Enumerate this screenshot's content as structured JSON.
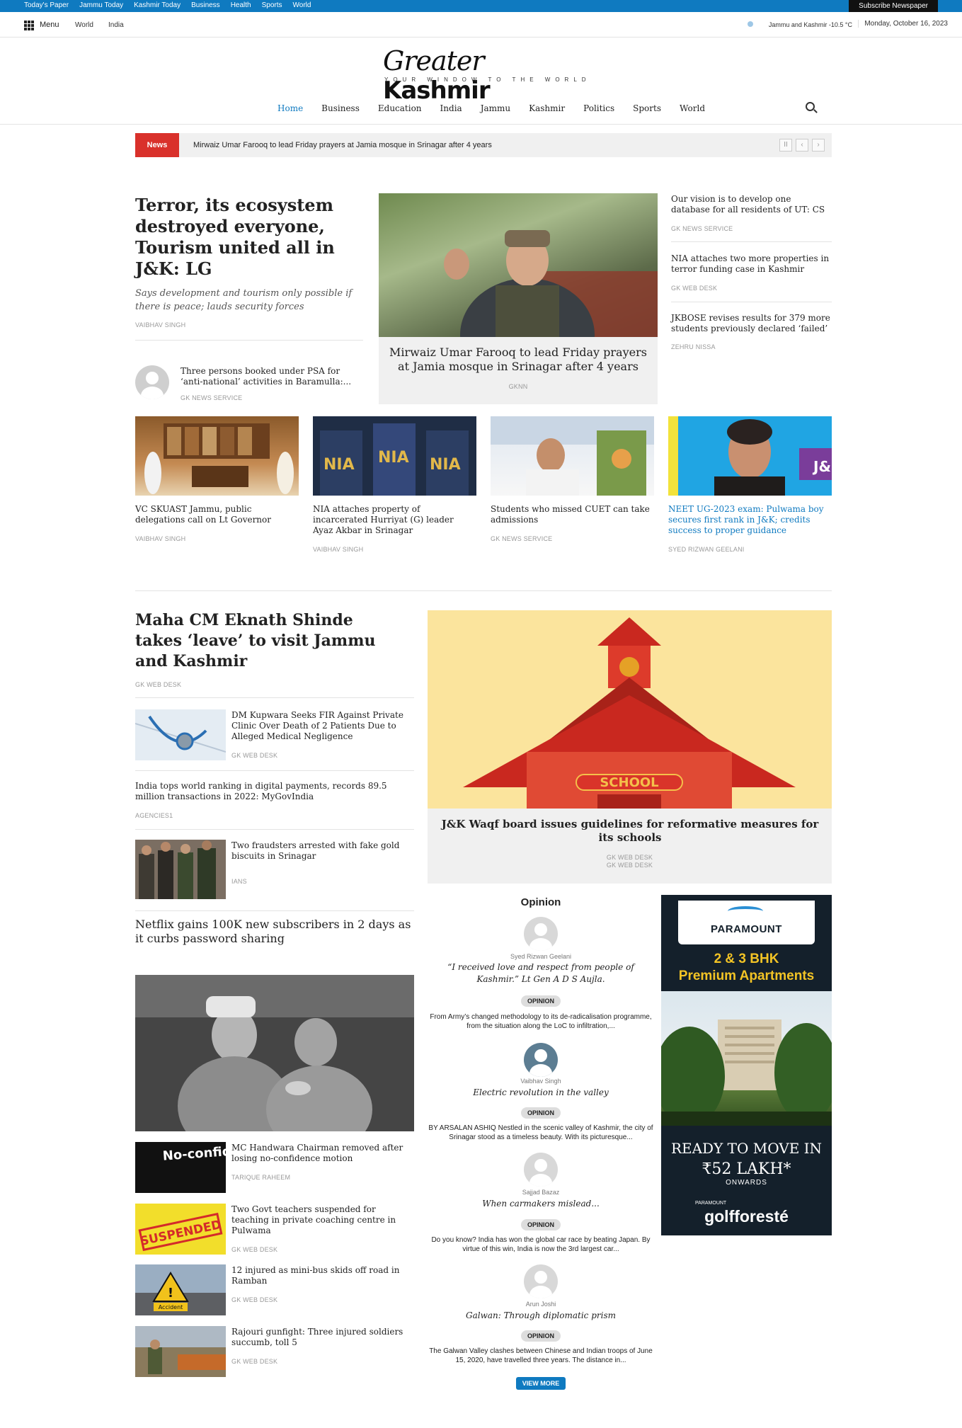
{
  "topbar": {
    "links": [
      "Today's Paper",
      "Jammu Today",
      "Kashmir Today",
      "Business",
      "Health",
      "Sports",
      "World"
    ],
    "subscribe": "Subscribe Newspaper"
  },
  "nav2": {
    "menu": "Menu",
    "world": "World",
    "india": "India",
    "weather": "Jammu and Kashmir  -10.5 °C",
    "date": "Monday, October 16, 2023"
  },
  "logo": {
    "greater": "Greater",
    "kashmir": "Kashmir",
    "tagline": "YOUR WINDOW TO THE WORLD"
  },
  "mainnav": [
    "Home",
    "Business",
    "Education",
    "India",
    "Jammu",
    "Kashmir",
    "Politics",
    "Sports",
    "World"
  ],
  "ticker": {
    "label": "News",
    "text": "Mirwaiz Umar Farooq to lead Friday prayers at Jamia mosque in Srinagar after 4 years"
  },
  "lead": {
    "title": "Terror, its ecosystem destroyed everyone, Tourism united all in J&K: LG",
    "subtitle": "Says development and tourism only possible if there is peace; lauds security forces",
    "author": "VAIBHAV SINGH"
  },
  "small_story": {
    "title": "Three persons booked under PSA for ‘anti-national’ activities in Baramulla:...",
    "author": "GK NEWS SERVICE"
  },
  "center_story": {
    "title": "Mirwaiz Umar Farooq to lead Friday prayers at Jamia mosque in Srinagar after 4 years",
    "author": "GKNN"
  },
  "right_list": [
    {
      "title": "Our vision is to develop one database for all residents of UT: CS",
      "author": "GK NEWS SERVICE"
    },
    {
      "title": "NIA attaches two more properties in terror funding case in Kashmir",
      "author": "GK WEB DESK"
    },
    {
      "title": "JKBOSE revises results for 379 more students previously declared ‘failed’",
      "author": "ZEHRU NISSA"
    }
  ],
  "row_cards": [
    {
      "title": "VC SKUAST Jammu, public delegations call on Lt Governor",
      "author": "VAIBHAV SINGH"
    },
    {
      "title": "NIA attaches property of incarcerated Hurriyat (G) leader Ayaz Akbar in Srinagar",
      "author": "VAIBHAV SINGH"
    },
    {
      "title": "Students who missed CUET can take admissions",
      "author": "GK NEWS SERVICE"
    },
    {
      "title": "NEET UG-2023 exam: Pulwama boy secures first rank in J&K; credits success to proper guidance",
      "author": "SYED RIZWAN GEELANI"
    }
  ],
  "section2": {
    "headline": "Maha CM Eknath Shinde takes ‘leave’ to visit Jammu and Kashmir",
    "headline_author": "GK WEB DESK",
    "list": [
      {
        "title": "DM Kupwara Seeks FIR Against Private Clinic Over Death of 2 Patients Due to Alleged Medical Negligence",
        "author": "GK WEB DESK"
      },
      {
        "title": "India tops world ranking in digital payments, records 89.5 million transactions in 2022: MyGovIndia",
        "author": "AGENCIES1"
      },
      {
        "title": "Two fraudsters arrested with fake gold biscuits in Srinagar",
        "author": "IANS"
      }
    ],
    "netflix": "Netflix gains 100K new subscribers in 2 days as it curbs password sharing",
    "waqf_title": "J&K Waqf board issues guidelines for reformative measures for its schools",
    "waqf_author_1": "GK WEB DESK",
    "waqf_author_2": "GK WEB DESK",
    "school_sign": "SCHOOL"
  },
  "bottom_list": [
    {
      "title": "MC Handwara Chairman removed after losing no-confidence motion",
      "author": "TARIQUE RAHEEM",
      "thumb_text": "No-confidence motion"
    },
    {
      "title": "Two Govt teachers suspended for teaching in private coaching centre in Pulwama",
      "author": "GK WEB DESK",
      "thumb_text": "SUSPENDED"
    },
    {
      "title": "12 injured as mini-bus skids off road in Ramban",
      "author": "GK WEB DESK",
      "thumb_text": "Accident"
    },
    {
      "title": "Rajouri gunfight: Three injured soldiers succumb, toll 5",
      "author": "GK WEB DESK"
    }
  ],
  "opinion": {
    "heading": "Opinion",
    "badge": "OPINION",
    "items": [
      {
        "name": "Syed Rizwan Geelani",
        "title": "“I received love and respect from people of Kashmir.” Lt Gen A D S Aujla.",
        "text": "From Army’s changed methodology to its de-radicalisation programme, from the situation along the LoC to infiltration,..."
      },
      {
        "name": "Vaibhav Singh",
        "title": "Electric revolution in the valley",
        "text": "BY ARSALAN ASHIQ Nestled in the scenic valley of Kashmir, the city of Srinagar stood as a timeless beauty. With its picturesque..."
      },
      {
        "name": "Sajjad Bazaz",
        "title": "When carmakers mislead...",
        "text": "Do you know? India has won the global car race by beating Japan. By virtue of this win, India is now the 3rd largest car..."
      },
      {
        "name": "Arun Joshi",
        "title": "Galwan: Through diplomatic prism",
        "text": "The Galwan Valley clashes between Chinese and Indian troops of  June 15, 2020, have travelled three years. The distance in..."
      }
    ],
    "view_more": "VIEW MORE"
  },
  "ad": {
    "brand": "PARAMOUNT",
    "bhk": "2 & 3 BHK",
    "premium": "Premium Apartments",
    "ready": "READY TO MOVE IN",
    "price": "₹52 LAKH*",
    "onwards": "ONWARDS",
    "small_brand": "PARAMOUNT",
    "project": "golfforesté"
  },
  "colors": {
    "topbar": "#0f7ac0",
    "accent": "#0f7ac0",
    "news_label": "#d9312b",
    "ad_bg": "#14202b"
  }
}
